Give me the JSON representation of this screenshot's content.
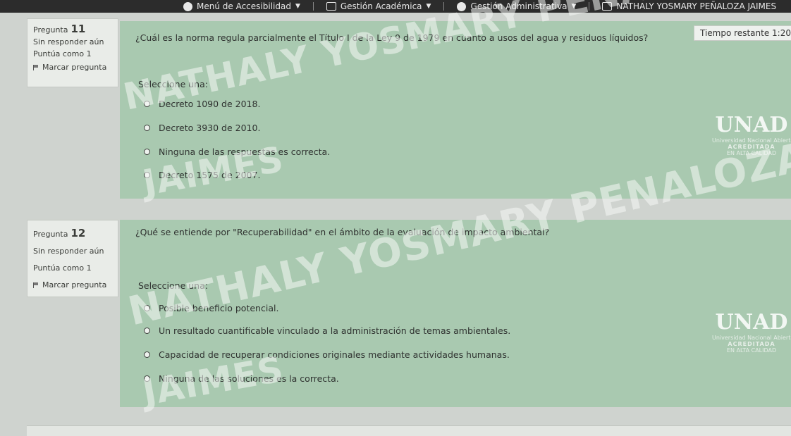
{
  "topbar": {
    "accessibility": "Menú de Accesibilidad",
    "academic": "Gestión Académica",
    "admin": "Gestión Administrativa",
    "user": "NATHALY YOSMARY PEÑALOZA JAIMES"
  },
  "timer": {
    "label": "Tiempo restante 1:20"
  },
  "questions": [
    {
      "label": "Pregunta",
      "number": "11",
      "status": "Sin responder aún",
      "score": "Puntúa como 1",
      "flag": "Marcar pregunta",
      "text": "¿Cuál es la norma regula parcialmente el Título I de la Ley 9 de 1979 en cuanto a usos del agua y residuos líquidos?",
      "prompt": "Seleccione una:",
      "options": [
        "Decreto 1090 de 2018.",
        "Decreto 3930 de 2010.",
        "Ninguna de las respuestas es correcta.",
        "Decreto 1575 de 2007."
      ]
    },
    {
      "label": "Pregunta",
      "number": "12",
      "status": "Sin responder aún",
      "score": "Puntúa como 1",
      "flag": "Marcar pregunta",
      "text": "¿Qué se entiende por \"Recuperabilidad\" en el ámbito de la evaluación de impacto ambiental?",
      "prompt": "Seleccione una:",
      "options": [
        "Posible beneficio potencial.",
        "Un resultado cuantificable vinculado a la administración de temas ambientales.",
        "Capacidad de recuperar condiciones originales mediante actividades humanas.",
        "Ninguna de las soluciones es la correcta."
      ]
    }
  ],
  "watermark": {
    "line1": "NATHALY YOSMARY PENALOZA",
    "line2": "JAIMES"
  },
  "logo": {
    "name": "UNAD",
    "sub": "Universidad Nacional Abierta y a Distancia",
    "accredited": "ACREDITADA",
    "quality": "EN ALTA CALIDAD"
  },
  "colors": {
    "content_bg": "#a9c9b0",
    "info_bg": "#e9ece8",
    "topbar_bg": "#2c2c2c"
  }
}
